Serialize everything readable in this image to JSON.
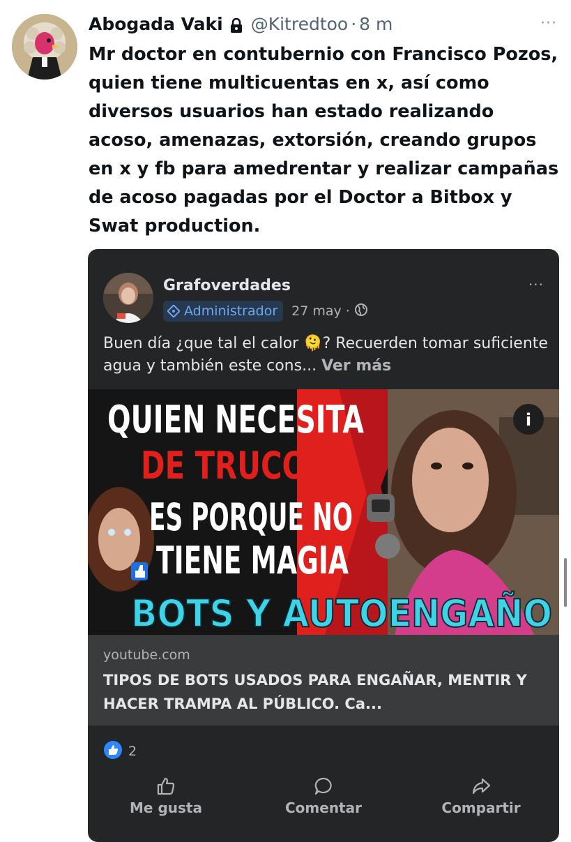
{
  "tweet": {
    "author_name": "Abogada Vaki",
    "handle": "@Kitredtoo",
    "separator": "·",
    "time": "8 m",
    "more_label": "···",
    "text": "Mr doctor en contubernio con Francisco Pozos, quien tiene multicuentas en x, así como diversos usuarios han estado realizando acoso, amenazas, extorsión, creando grupos en x y fb para amedrentar y realizar campañas de acoso pagadas por el Doctor a Bitbox y Swat production."
  },
  "fb_post": {
    "page_name": "Grafoverdades",
    "role_badge": "Administrador",
    "date": "27 may",
    "separator": "·",
    "more_label": "···",
    "text": "Buen día ¿que tal el calor 🫠? Recuerden tomar suficiente agua y también este cons...",
    "see_more": "Ver más",
    "thumbnail": {
      "line1": "QUIEN NECESITA",
      "line2": "DE TRUCOS",
      "line3": "ES PORQUE NO",
      "line4": "TIENE MAGIA",
      "banner": "BOTS Y AUTOENGAÑO",
      "info_label": "i"
    },
    "link": {
      "domain": "youtube.com",
      "title": "TIPOS DE BOTS USADOS PARA ENGAÑAR, MENTIR Y HACER TRAMPA AL PÚBLICO. Ca..."
    },
    "reaction_count": "2",
    "actions": {
      "like": "Me gusta",
      "comment": "Comentar",
      "share": "Compartir"
    }
  },
  "colors": {
    "fb_card_bg": "#242526",
    "fb_link_bg": "#3a3b3c",
    "fb_accent": "#2d88ff",
    "thumbnail_red": "#e0201c",
    "banner_cyan": "#3fd3e8"
  },
  "icons": [
    "lock-icon",
    "globe-icon",
    "admin-badge-icon",
    "like-reaction-icon",
    "thumbs-up-icon",
    "comment-icon",
    "share-icon",
    "info-icon",
    "more-options-icon"
  ]
}
